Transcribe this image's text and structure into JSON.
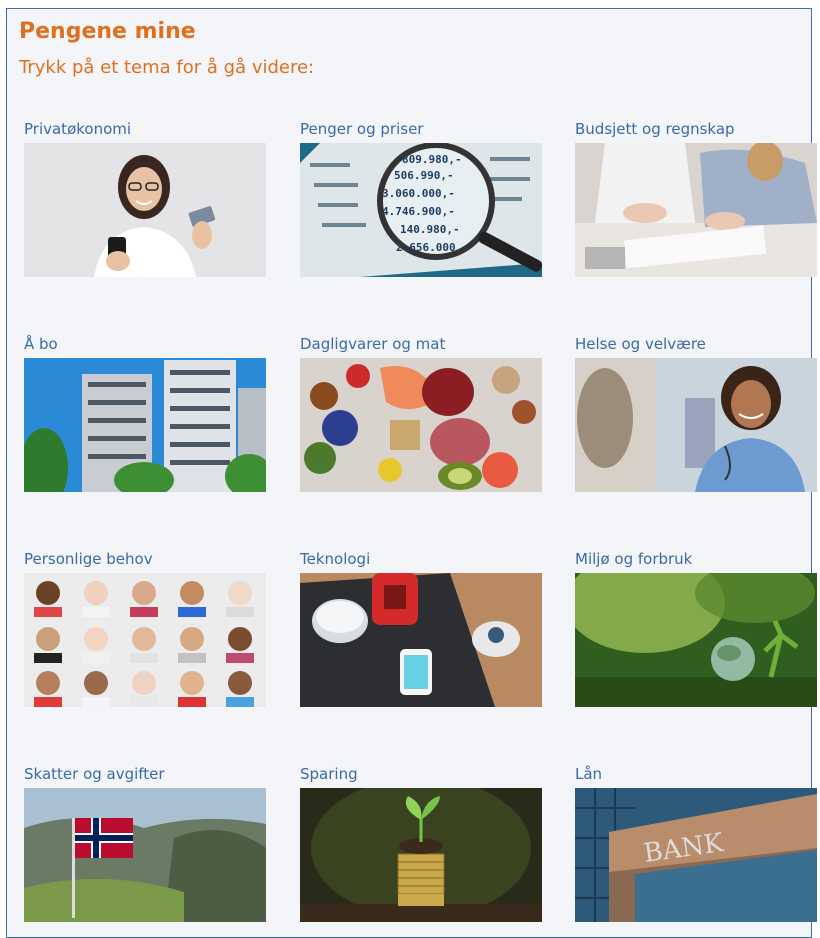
{
  "header": {
    "title": "Pengene mine",
    "subtitle": "Trykk på et tema for å gå videre:"
  },
  "topics": [
    {
      "label": "Privatøkonomi",
      "icon": "woman-phone-card-photo"
    },
    {
      "label": "Penger og priser",
      "icon": "magnifier-prices-photo"
    },
    {
      "label": "Budsjett og regnskap",
      "icon": "people-accounting-photo"
    },
    {
      "label": "Å bo",
      "icon": "apartment-buildings-photo"
    },
    {
      "label": "Dagligvarer og mat",
      "icon": "groceries-food-photo"
    },
    {
      "label": "Helse og velvære",
      "icon": "nurse-photo"
    },
    {
      "label": "Personlige behov",
      "icon": "faces-grid-photo"
    },
    {
      "label": "Teknologi",
      "icon": "smart-devices-photo"
    },
    {
      "label": "Miljø og forbruk",
      "icon": "green-globe-photo"
    },
    {
      "label": "Skatter og avgifter",
      "icon": "norwegian-flag-photo"
    },
    {
      "label": "Sparing",
      "icon": "coin-stack-sprout-photo"
    },
    {
      "label": "Lån",
      "icon": "bank-building-photo"
    }
  ],
  "images": {
    "prices_text": [
      "809.980,-",
      "506.990,-",
      "3.060.000,-",
      "4.746.900,-",
      "140.980,-",
      "2.656.000,-"
    ],
    "bank_sign": "BANK"
  },
  "colors": {
    "accent_orange": "#e07020",
    "label_blue": "#3a6aa8",
    "background": "#f3f5f9",
    "border": "#3a6fb0"
  }
}
